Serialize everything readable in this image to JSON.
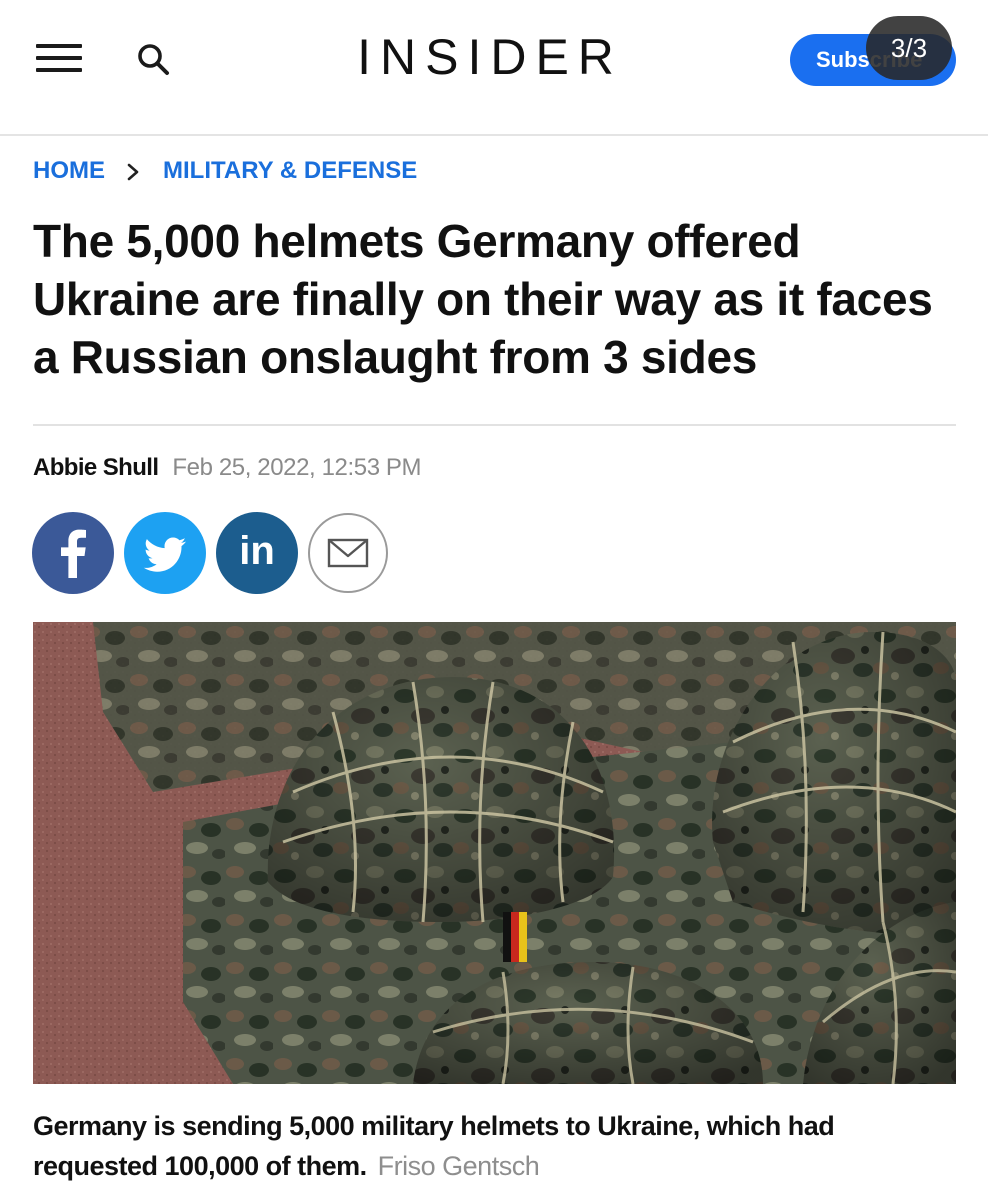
{
  "header": {
    "logo": "INSIDER",
    "subscribe_label": "Subscribe",
    "page_counter": "3/3"
  },
  "breadcrumb": {
    "home": "HOME",
    "section": "MILITARY & DEFENSE"
  },
  "article": {
    "headline": "The 5,000 helmets Germany offered Ukraine are finally on their way as it faces a Russian onslaught from 3 sides",
    "author": "Abbie Shull",
    "date": "Feb 25, 2022, 12:53 PM"
  },
  "share": {
    "facebook_icon": "facebook-icon",
    "twitter_icon": "twitter-icon",
    "linkedin_icon": "linkedin-icon",
    "email_icon": "email-icon",
    "linkedin_text": "in"
  },
  "photo": {
    "caption": "Germany is sending 5,000 military helmets to Ukraine, which had requested 100,000 of them.",
    "credit": "Friso Gentsch"
  },
  "colors": {
    "accent_blue": "#1a6fdc",
    "subscribe_blue": "#1a6ff0",
    "facebook": "#3b5998",
    "twitter": "#1da1f2",
    "linkedin": "#1c5d8e"
  }
}
